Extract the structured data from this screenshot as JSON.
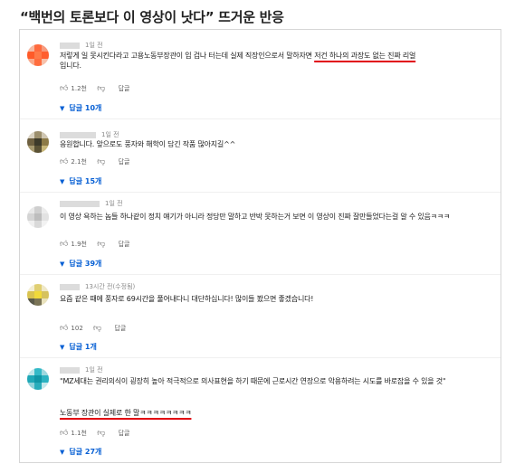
{
  "headline": "“백번의 토론보다 이 영상이 낫다” 뜨거운 반응",
  "comments": [
    {
      "time": "1일 전",
      "text_a": "저렇게 일 못시킨다라고 고용노동부장관이 입 겁나 터는데 실제 직장인으로서 말하자면 ",
      "text_hl": "저건 하나의 과장도 없는 진짜 리얼",
      "text_b": "입니다.",
      "likes": "1.2천",
      "reply_label": "답글",
      "replies": "답글 10개"
    },
    {
      "time": "1일 전",
      "text": "응원합니다. 앞으로도 풍자와 해학이 담긴 작품 많아지길^^",
      "likes": "2.1천",
      "reply_label": "답글",
      "replies": "답글 15개"
    },
    {
      "time": "1일 전",
      "text": "이 영상 욕하는 놈들 하나같이 정치 얘기가 아니라 정당만 말하고 반박 못하는거 보면 이 영상이 진짜 잘만들었다는걸 알 수 있음ㅋㅋㅋ",
      "likes": "1.9천",
      "reply_label": "답글",
      "replies": "답글 39개"
    },
    {
      "time": "13시간 전(수정됨)",
      "text": "요즘 같은 때에 풍자로 69시간을 풀어내다니 대단하십니다! 많이들 봤으면 좋겠습니다!",
      "likes": "102",
      "reply_label": "답글",
      "replies": "답글 1개"
    },
    {
      "time": "1일 전",
      "text": "\"MZ세대는 권리의식이 굉장히 높아 적극적으로 의사표현을 하기 때문에 근로시간 연장으로 악용하려는 시도를 바로잡을 수 있을 것\"",
      "text_hl": "노동부 장관이 실제로 한 말ㅋㅋㅋㅋㅋㅋㅋㅋ",
      "likes": "1.1천",
      "reply_label": "답글",
      "replies": "답글 27개"
    }
  ],
  "icons": {
    "like": "thumbs-up-icon",
    "dislike": "thumbs-down-icon",
    "caret": "caret-down-icon"
  },
  "colors": {
    "link": "#065fd4",
    "highlight_underline": "#e1000f"
  }
}
